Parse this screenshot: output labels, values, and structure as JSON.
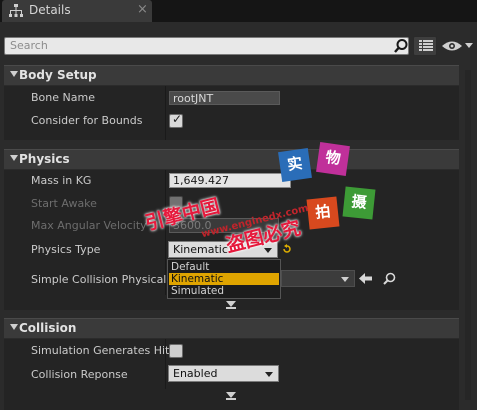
{
  "tab": {
    "title": "Details",
    "close": "×"
  },
  "search": {
    "placeholder": "Search"
  },
  "sections": {
    "body_setup": {
      "title": "Body Setup",
      "bone_name_label": "Bone Name",
      "bone_name_value": "rootJNT",
      "consider_bounds_label": "Consider for Bounds",
      "consider_bounds_checked": true
    },
    "physics": {
      "title": "Physics",
      "mass_label": "Mass in KG",
      "mass_value": "1,649.427",
      "start_awake_label": "Start Awake",
      "max_angular_label": "Max Angular Velocity",
      "max_angular_value": "3600.0",
      "physics_type_label": "Physics Type",
      "physics_type_value": "Kinematic",
      "simple_collision_label": "Simple Collision Physical",
      "physics_type_options": [
        "Default",
        "Kinematic",
        "Simulated"
      ],
      "physics_type_selected": "Kinematic"
    },
    "collision": {
      "title": "Collision",
      "sim_hit_label": "Simulation Generates Hit I",
      "sim_hit_checked": false,
      "collision_response_label": "Collision Reponse",
      "collision_response_value": "Enabled"
    }
  },
  "watermark": {
    "badge1": "实",
    "badge2": "物",
    "badge3": "拍",
    "badge4": "摄",
    "text1": "引擎中国",
    "text2": "盗图必究",
    "url": "www.enginedx.com"
  },
  "colors": {
    "accent_selected": "#dfa400",
    "background": "#2b2b2b",
    "header": "#3a3a3a"
  }
}
